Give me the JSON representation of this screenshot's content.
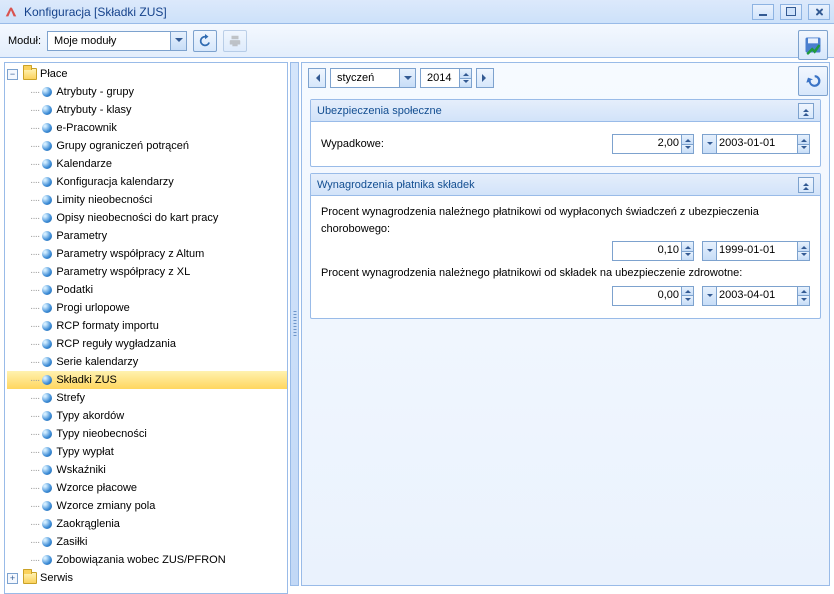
{
  "window": {
    "title": "Konfiguracja [Składki ZUS]"
  },
  "toolbar": {
    "module_label": "Moduł:",
    "module_value": "Moje moduły"
  },
  "tree": {
    "root1": {
      "label": "Płace",
      "expanded": true
    },
    "root2": {
      "label": "Serwis",
      "expanded": false
    },
    "items": [
      "Atrybuty - grupy",
      "Atrybuty - klasy",
      "e-Pracownik",
      "Grupy ograniczeń potrąceń",
      "Kalendarze",
      "Konfiguracja kalendarzy",
      "Limity nieobecności",
      "Opisy nieobecności do kart pracy",
      "Parametry",
      "Parametry współpracy z Altum",
      "Parametry współpracy z XL",
      "Podatki",
      "Progi urlopowe",
      "RCP formaty importu",
      "RCP reguły wygładzania",
      "Serie kalendarzy",
      "Składki ZUS",
      "Strefy",
      "Typy akordów",
      "Typy nieobecności",
      "Typy wypłat",
      "Wskaźniki",
      "Wzorce płacowe",
      "Wzorce zmiany pola",
      "Zaokrąglenia",
      "Zasiłki",
      "Zobowiązania wobec ZUS/PFRON"
    ],
    "selected": "Składki ZUS"
  },
  "datebar": {
    "month": "styczeń",
    "year": "2014"
  },
  "sections": {
    "ubezp": {
      "title": "Ubezpieczenia społeczne",
      "row1_label": "Wypadkowe:",
      "row1_value": "2,00",
      "row1_date": "2003-01-01"
    },
    "wynag": {
      "title": "Wynagrodzenia płatnika składek",
      "text1": "Procent wynagrodzenia należnego płatnikowi od wypłaconych świadczeń z ubezpieczenia chorobowego:",
      "val1": "0,10",
      "date1": "1999-01-01",
      "text2": "Procent wynagrodzenia należnego płatnikowi od składek na ubezpieczenie zdrowotne:",
      "val2": "0,00",
      "date2": "2003-04-01"
    }
  }
}
